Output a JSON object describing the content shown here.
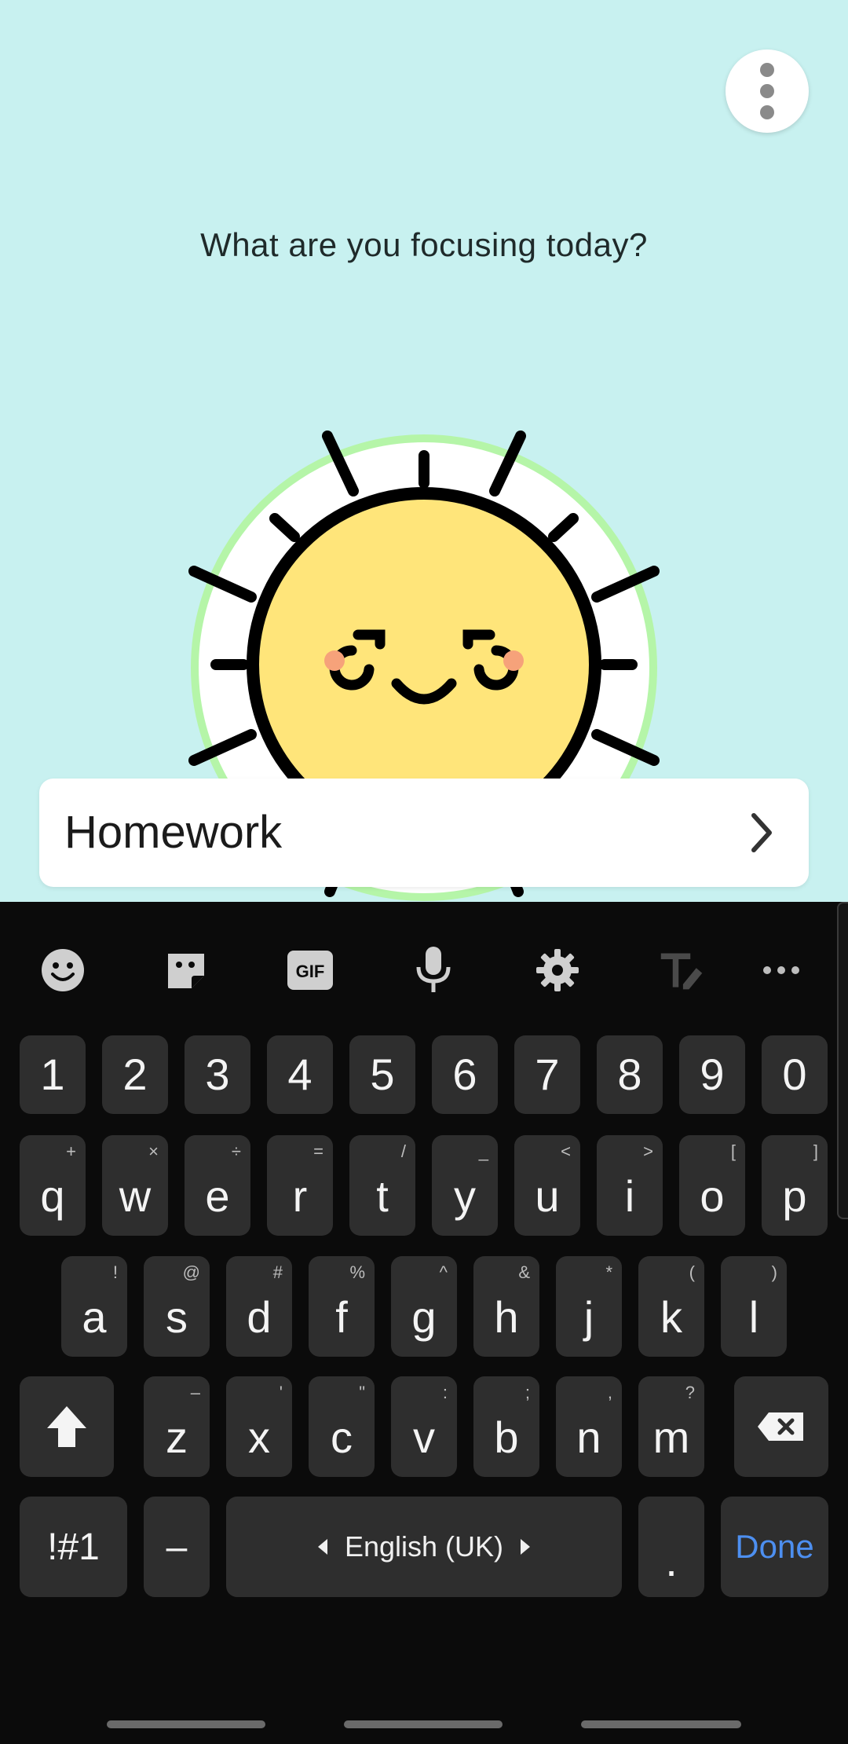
{
  "app": {
    "prompt": "What are you focusing today?",
    "menu_icon": "more-vert-icon",
    "task_input": {
      "value": "Homework",
      "submit_icon": "chevron-right-icon"
    },
    "colors": {
      "background": "#c8f1f0",
      "sun_face": "#ffe57a",
      "cheek": "#f6a27a",
      "halo": "#b5f5a8"
    }
  },
  "keyboard": {
    "toolbar": [
      {
        "icon": "emoji-icon"
      },
      {
        "icon": "sticker-icon"
      },
      {
        "icon": "gif-icon",
        "label": "GIF"
      },
      {
        "icon": "microphone-icon"
      },
      {
        "icon": "settings-gear-icon"
      },
      {
        "icon": "text-edit-icon"
      },
      {
        "icon": "more-horiz-icon"
      }
    ],
    "number_row": [
      "1",
      "2",
      "3",
      "4",
      "5",
      "6",
      "7",
      "8",
      "9",
      "0"
    ],
    "row1": [
      {
        "k": "q",
        "s": "+"
      },
      {
        "k": "w",
        "s": "×"
      },
      {
        "k": "e",
        "s": "÷"
      },
      {
        "k": "r",
        "s": "="
      },
      {
        "k": "t",
        "s": "/"
      },
      {
        "k": "y",
        "s": "_"
      },
      {
        "k": "u",
        "s": "<"
      },
      {
        "k": "i",
        "s": ">"
      },
      {
        "k": "o",
        "s": "["
      },
      {
        "k": "p",
        "s": "]"
      }
    ],
    "row2": [
      {
        "k": "a",
        "s": "!"
      },
      {
        "k": "s",
        "s": "@"
      },
      {
        "k": "d",
        "s": "#"
      },
      {
        "k": "f",
        "s": "%"
      },
      {
        "k": "g",
        "s": "^"
      },
      {
        "k": "h",
        "s": "&"
      },
      {
        "k": "j",
        "s": "*"
      },
      {
        "k": "k",
        "s": "("
      },
      {
        "k": "l",
        "s": ")"
      }
    ],
    "row3": [
      {
        "k": "z",
        "s": "–"
      },
      {
        "k": "x",
        "s": "'"
      },
      {
        "k": "c",
        "s": "\""
      },
      {
        "k": "v",
        "s": ":"
      },
      {
        "k": "b",
        "s": ";"
      },
      {
        "k": "n",
        "s": ","
      },
      {
        "k": "m",
        "s": "?"
      }
    ],
    "shift_icon": "shift-arrow-icon",
    "backspace_icon": "backspace-icon",
    "symbols_label": "!#1",
    "dash_label": "–",
    "space_label": "English (UK)",
    "period_label": ".",
    "done_label": "Done"
  }
}
